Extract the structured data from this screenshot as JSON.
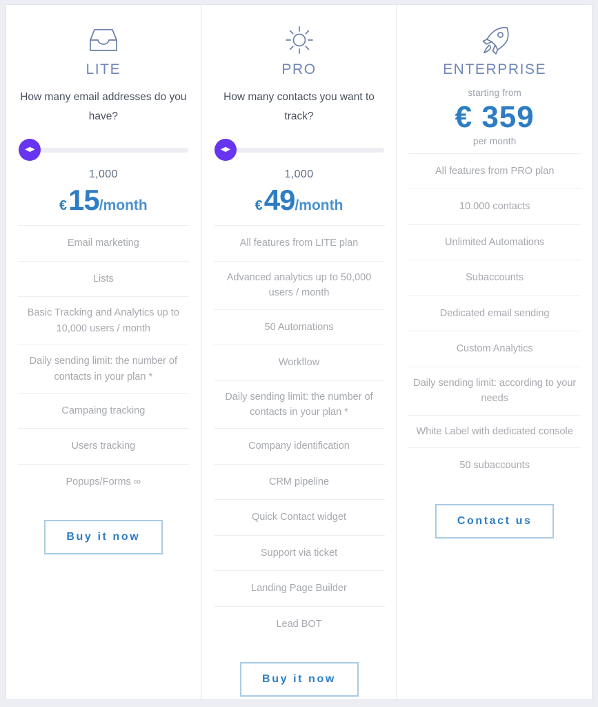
{
  "theme": {
    "page_background": "#eceef3",
    "card_background": "#ffffff",
    "accent_blue": "#2e7dc4",
    "title_blue": "#6f87b8",
    "slider_purple": "#6734ef",
    "feature_text": "#a5a8ae",
    "cta_border": "#a8cbe4"
  },
  "plans": [
    {
      "id": "lite",
      "icon": "inbox-tray-icon",
      "title": "LITE",
      "question": "How many email addresses do you have?",
      "slider": {
        "handle_glyph": "◀▶",
        "value": "1,000",
        "position_percent": 0
      },
      "price": {
        "currency": "€",
        "amount": "15",
        "period": "/month"
      },
      "features": [
        "Email marketing",
        "Lists",
        "Basic Tracking and Analytics up to 10,000 users / month",
        "Daily sending limit: the number of contacts in your plan *",
        "Campaing tracking",
        "Users tracking",
        "Popups/Forms ∞"
      ],
      "cta": "Buy it now"
    },
    {
      "id": "pro",
      "icon": "sun-icon",
      "title": "PRO",
      "question": "How many contacts you want to track?",
      "slider": {
        "handle_glyph": "◀▶",
        "value": "1,000",
        "position_percent": 0
      },
      "price": {
        "currency": "€",
        "amount": "49",
        "period": "/month"
      },
      "features": [
        "All features from LITE plan",
        "Advanced analytics up to 50,000 users / month",
        "50 Automations",
        "Workflow",
        "Daily sending limit: the number of contacts in your plan *",
        "Company identification",
        "CRM pipeline",
        "Quick Contact widget",
        "Support via ticket",
        "Landing Page Builder",
        "Lead BOT"
      ],
      "cta": "Buy it now"
    },
    {
      "id": "enterprise",
      "icon": "rocket-icon",
      "title": "ENTERPRISE",
      "starting_from_label": "starting from",
      "price_display": "€ 359",
      "per_month_label": "per month",
      "features": [
        "All features from PRO plan",
        "10.000 contacts",
        "Unlimited Automations",
        "Subaccounts",
        "Dedicated email sending",
        "Custom Analytics",
        "Daily sending limit: according to your needs",
        "White Label with dedicated console",
        "50 subaccounts"
      ],
      "cta": "Contact us"
    }
  ]
}
